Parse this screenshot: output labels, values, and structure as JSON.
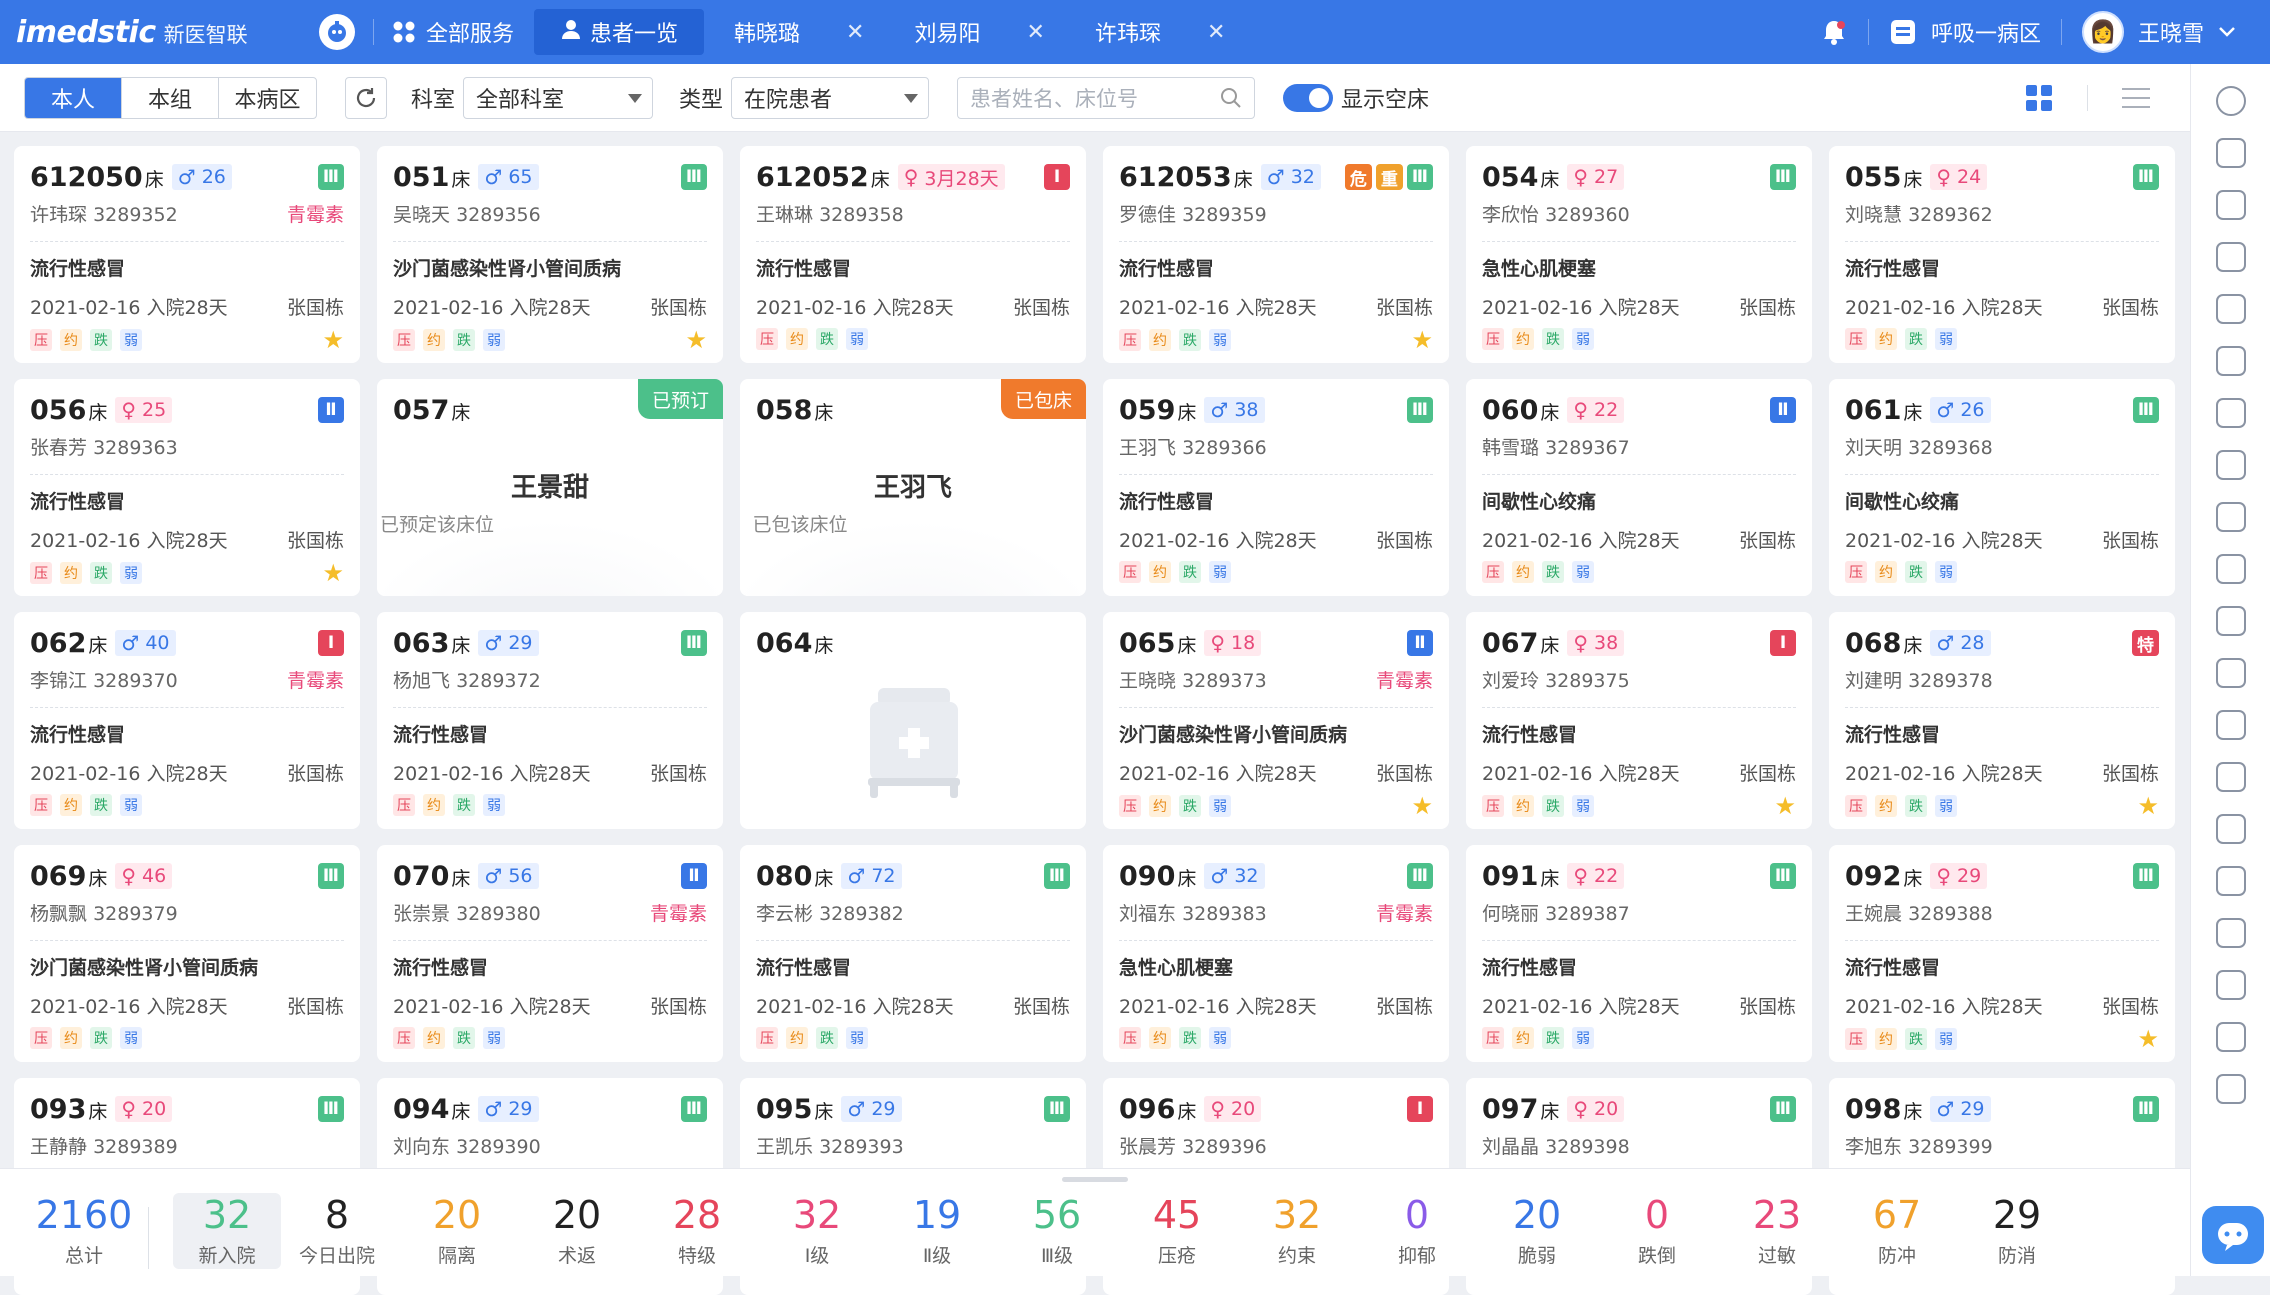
{
  "app": {
    "logo_en": "imedstic",
    "logo_cn": "新医智联",
    "all_services": "全部服务"
  },
  "tabs": [
    {
      "label": "患者一览",
      "active": true
    },
    {
      "label": "韩晓璐"
    },
    {
      "label": "刘易阳"
    },
    {
      "label": "许玮琛"
    }
  ],
  "user": {
    "ward": "呼吸一病区",
    "name": "王晓雪"
  },
  "toolbar": {
    "scope": [
      "本人",
      "本组",
      "本病区"
    ],
    "dept_label": "科室",
    "dept_value": "全部科室",
    "type_label": "类型",
    "type_value": "在院患者",
    "search_placeholder": "患者姓名、床位号",
    "show_empty": "显示空床"
  },
  "labels": {
    "bed_suffix": "床",
    "admit_prefix": "入院",
    "tags": [
      "压",
      "约",
      "跌",
      "弱"
    ],
    "allergy": "青霉素"
  },
  "beds": [
    {
      "bed": "612050",
      "sex": "m",
      "age": "26",
      "name": "许玮琛",
      "id": "3289352",
      "allergy": "青霉素",
      "levels": [
        [
          "Ⅲ",
          "l3"
        ]
      ],
      "diag": "流行性感冒",
      "date": "2021-02-16",
      "days": "入院28天",
      "doctor": "张国栋",
      "star": true
    },
    {
      "bed": "051",
      "sex": "m",
      "age": "65",
      "name": "吴晓天",
      "id": "3289356",
      "levels": [
        [
          "Ⅲ",
          "l3"
        ]
      ],
      "diag": "沙门菌感染性肾小管间质病",
      "date": "2021-02-16",
      "days": "入院28天",
      "doctor": "张国栋",
      "star": true
    },
    {
      "bed": "612052",
      "sex": "f",
      "age": "3月28天",
      "name": "王琳琳",
      "id": "3289358",
      "levels": [
        [
          "Ⅰ",
          "l1"
        ]
      ],
      "diag": "流行性感冒",
      "date": "2021-02-16",
      "days": "入院28天",
      "doctor": "张国栋"
    },
    {
      "bed": "612053",
      "sex": "m",
      "age": "32",
      "name": "罗德佳",
      "id": "3289359",
      "levels": [
        [
          "危",
          "lw"
        ],
        [
          "重",
          "lz"
        ],
        [
          "Ⅲ",
          "l3"
        ]
      ],
      "diag": "流行性感冒",
      "date": "2021-02-16",
      "days": "入院28天",
      "doctor": "张国栋",
      "star": true
    },
    {
      "bed": "054",
      "sex": "f",
      "age": "27",
      "name": "李欣怡",
      "id": "3289360",
      "levels": [
        [
          "Ⅲ",
          "l3"
        ]
      ],
      "diag": "急性心肌梗塞",
      "date": "2021-02-16",
      "days": "入院28天",
      "doctor": "张国栋"
    },
    {
      "bed": "055",
      "sex": "f",
      "age": "24",
      "name": "刘晓慧",
      "id": "3289362",
      "levels": [
        [
          "Ⅲ",
          "l3"
        ]
      ],
      "diag": "流行性感冒",
      "date": "2021-02-16",
      "days": "入院28天",
      "doctor": "张国栋"
    },
    {
      "bed": "056",
      "sex": "f",
      "age": "25",
      "name": "张春芳",
      "id": "3289363",
      "levels": [
        [
          "Ⅱ",
          "l2"
        ]
      ],
      "diag": "流行性感冒",
      "date": "2021-02-16",
      "days": "入院28天",
      "doctor": "张国栋",
      "star": true
    },
    {
      "bed": "057",
      "kind": "reserved",
      "ribbon": "已预订",
      "ribbon_color": "rb-g",
      "rname": "王景甜",
      "rstatus": "已预定该床位"
    },
    {
      "bed": "058",
      "kind": "reserved",
      "ribbon": "已包床",
      "ribbon_color": "rb-o",
      "rname": "王羽飞",
      "rstatus": "已包该床位"
    },
    {
      "bed": "059",
      "sex": "m",
      "age": "38",
      "name": "王羽飞",
      "id": "3289366",
      "levels": [
        [
          "Ⅲ",
          "l3"
        ]
      ],
      "diag": "流行性感冒",
      "date": "2021-02-16",
      "days": "入院28天",
      "doctor": "张国栋"
    },
    {
      "bed": "060",
      "sex": "f",
      "age": "22",
      "name": "韩雪璐",
      "id": "3289367",
      "levels": [
        [
          "Ⅱ",
          "l2"
        ]
      ],
      "diag": "间歇性心绞痛",
      "date": "2021-02-16",
      "days": "入院28天",
      "doctor": "张国栋"
    },
    {
      "bed": "061",
      "sex": "m",
      "age": "26",
      "name": "刘天明",
      "id": "3289368",
      "levels": [
        [
          "Ⅲ",
          "l3"
        ]
      ],
      "diag": "间歇性心绞痛",
      "date": "2021-02-16",
      "days": "入院28天",
      "doctor": "张国栋"
    },
    {
      "bed": "062",
      "sex": "m",
      "age": "40",
      "name": "李锦江",
      "id": "3289370",
      "allergy": "青霉素",
      "levels": [
        [
          "Ⅰ",
          "l1"
        ]
      ],
      "diag": "流行性感冒",
      "date": "2021-02-16",
      "days": "入院28天",
      "doctor": "张国栋"
    },
    {
      "bed": "063",
      "sex": "m",
      "age": "29",
      "name": "杨旭飞",
      "id": "3289372",
      "levels": [
        [
          "Ⅲ",
          "l3"
        ]
      ],
      "diag": "流行性感冒",
      "date": "2021-02-16",
      "days": "入院28天",
      "doctor": "张国栋"
    },
    {
      "bed": "064",
      "kind": "empty"
    },
    {
      "bed": "065",
      "sex": "f",
      "age": "18",
      "name": "王晓晓",
      "id": "3289373",
      "allergy": "青霉素",
      "levels": [
        [
          "Ⅱ",
          "l2"
        ]
      ],
      "diag": "沙门菌感染性肾小管间质病",
      "date": "2021-02-16",
      "days": "入院28天",
      "doctor": "张国栋",
      "star": true
    },
    {
      "bed": "067",
      "sex": "f",
      "age": "38",
      "name": "刘爱玲",
      "id": "3289375",
      "levels": [
        [
          "Ⅰ",
          "l1"
        ]
      ],
      "diag": "流行性感冒",
      "date": "2021-02-16",
      "days": "入院28天",
      "doctor": "张国栋",
      "star": true
    },
    {
      "bed": "068",
      "sex": "m",
      "age": "28",
      "name": "刘建明",
      "id": "3289378",
      "levels": [
        [
          "特",
          "lt"
        ]
      ],
      "diag": "流行性感冒",
      "date": "2021-02-16",
      "days": "入院28天",
      "doctor": "张国栋",
      "star": true
    },
    {
      "bed": "069",
      "sex": "f",
      "age": "46",
      "name": "杨飘飘",
      "id": "3289379",
      "levels": [
        [
          "Ⅲ",
          "l3"
        ]
      ],
      "diag": "沙门菌感染性肾小管间质病",
      "date": "2021-02-16",
      "days": "入院28天",
      "doctor": "张国栋"
    },
    {
      "bed": "070",
      "sex": "m",
      "age": "56",
      "name": "张崇景",
      "id": "3289380",
      "allergy": "青霉素",
      "levels": [
        [
          "Ⅱ",
          "l2"
        ]
      ],
      "diag": "流行性感冒",
      "date": "2021-02-16",
      "days": "入院28天",
      "doctor": "张国栋"
    },
    {
      "bed": "080",
      "sex": "m",
      "age": "72",
      "name": "李云彬",
      "id": "3289382",
      "levels": [
        [
          "Ⅲ",
          "l3"
        ]
      ],
      "diag": "流行性感冒",
      "date": "2021-02-16",
      "days": "入院28天",
      "doctor": "张国栋"
    },
    {
      "bed": "090",
      "sex": "m",
      "age": "32",
      "name": "刘福东",
      "id": "3289383",
      "allergy": "青霉素",
      "levels": [
        [
          "Ⅲ",
          "l3"
        ]
      ],
      "diag": "急性心肌梗塞",
      "date": "2021-02-16",
      "days": "入院28天",
      "doctor": "张国栋"
    },
    {
      "bed": "091",
      "sex": "f",
      "age": "22",
      "name": "何晓丽",
      "id": "3289387",
      "levels": [
        [
          "Ⅲ",
          "l3"
        ]
      ],
      "diag": "流行性感冒",
      "date": "2021-02-16",
      "days": "入院28天",
      "doctor": "张国栋"
    },
    {
      "bed": "092",
      "sex": "f",
      "age": "29",
      "name": "王婉晨",
      "id": "3289388",
      "levels": [
        [
          "Ⅲ",
          "l3"
        ]
      ],
      "diag": "流行性感冒",
      "date": "2021-02-16",
      "days": "入院28天",
      "doctor": "张国栋",
      "star": true
    },
    {
      "bed": "093",
      "sex": "f",
      "age": "20",
      "name": "王静静",
      "id": "3289389",
      "levels": [
        [
          "Ⅲ",
          "l3"
        ]
      ]
    },
    {
      "bed": "094",
      "sex": "m",
      "age": "29",
      "name": "刘向东",
      "id": "3289390",
      "levels": [
        [
          "Ⅲ",
          "l3"
        ]
      ]
    },
    {
      "bed": "095",
      "sex": "m",
      "age": "29",
      "name": "王凯乐",
      "id": "3289393",
      "levels": [
        [
          "Ⅲ",
          "l3"
        ]
      ]
    },
    {
      "bed": "096",
      "sex": "f",
      "age": "20",
      "name": "张晨芳",
      "id": "3289396",
      "levels": [
        [
          "Ⅰ",
          "l1"
        ]
      ]
    },
    {
      "bed": "097",
      "sex": "f",
      "age": "20",
      "name": "刘晶晶",
      "id": "3289398",
      "levels": [
        [
          "Ⅲ",
          "l3"
        ]
      ]
    },
    {
      "bed": "098",
      "sex": "m",
      "age": "29",
      "name": "李旭东",
      "id": "3289399",
      "levels": [
        [
          "Ⅲ",
          "l3"
        ]
      ]
    }
  ],
  "stats": [
    {
      "v": "2160",
      "k": "总计",
      "c": "#3877e6"
    },
    {
      "v": "32",
      "k": "新入院",
      "c": "#4cc08a",
      "hl": true
    },
    {
      "v": "8",
      "k": "今日出院",
      "c": "#222"
    },
    {
      "v": "20",
      "k": "隔离",
      "c": "#f0a12c"
    },
    {
      "v": "20",
      "k": "术返",
      "c": "#222"
    },
    {
      "v": "28",
      "k": "特级",
      "c": "#e5455b"
    },
    {
      "v": "32",
      "k": "Ⅰ级",
      "c": "#e8497a"
    },
    {
      "v": "19",
      "k": "Ⅱ级",
      "c": "#3877e6"
    },
    {
      "v": "56",
      "k": "Ⅲ级",
      "c": "#4cc08a"
    },
    {
      "v": "45",
      "k": "压疮",
      "c": "#e5455b"
    },
    {
      "v": "32",
      "k": "约束",
      "c": "#f0a12c"
    },
    {
      "v": "0",
      "k": "抑郁",
      "c": "#8a5be8"
    },
    {
      "v": "20",
      "k": "脆弱",
      "c": "#3877e6"
    },
    {
      "v": "0",
      "k": "跌倒",
      "c": "#e8497a"
    },
    {
      "v": "23",
      "k": "过敏",
      "c": "#e8497a"
    },
    {
      "v": "67",
      "k": "防冲",
      "c": "#f0a12c"
    },
    {
      "v": "29",
      "k": "防消",
      "c": "#222"
    }
  ],
  "sidebar_icons": [
    "user-circle-icon",
    "monitor-icon",
    "clipboard-icon",
    "document-icon",
    "message-icon",
    "medical-record-icon",
    "checklist-icon",
    "screen-report-icon",
    "brain-icon",
    "heart-icon",
    "injection-icon",
    "nurse-icon",
    "drop-icon",
    "settings-icon",
    "feather-icon",
    "report-icon",
    "list-icon",
    "calendar-icon",
    "shield-icon",
    "satellite-icon"
  ]
}
